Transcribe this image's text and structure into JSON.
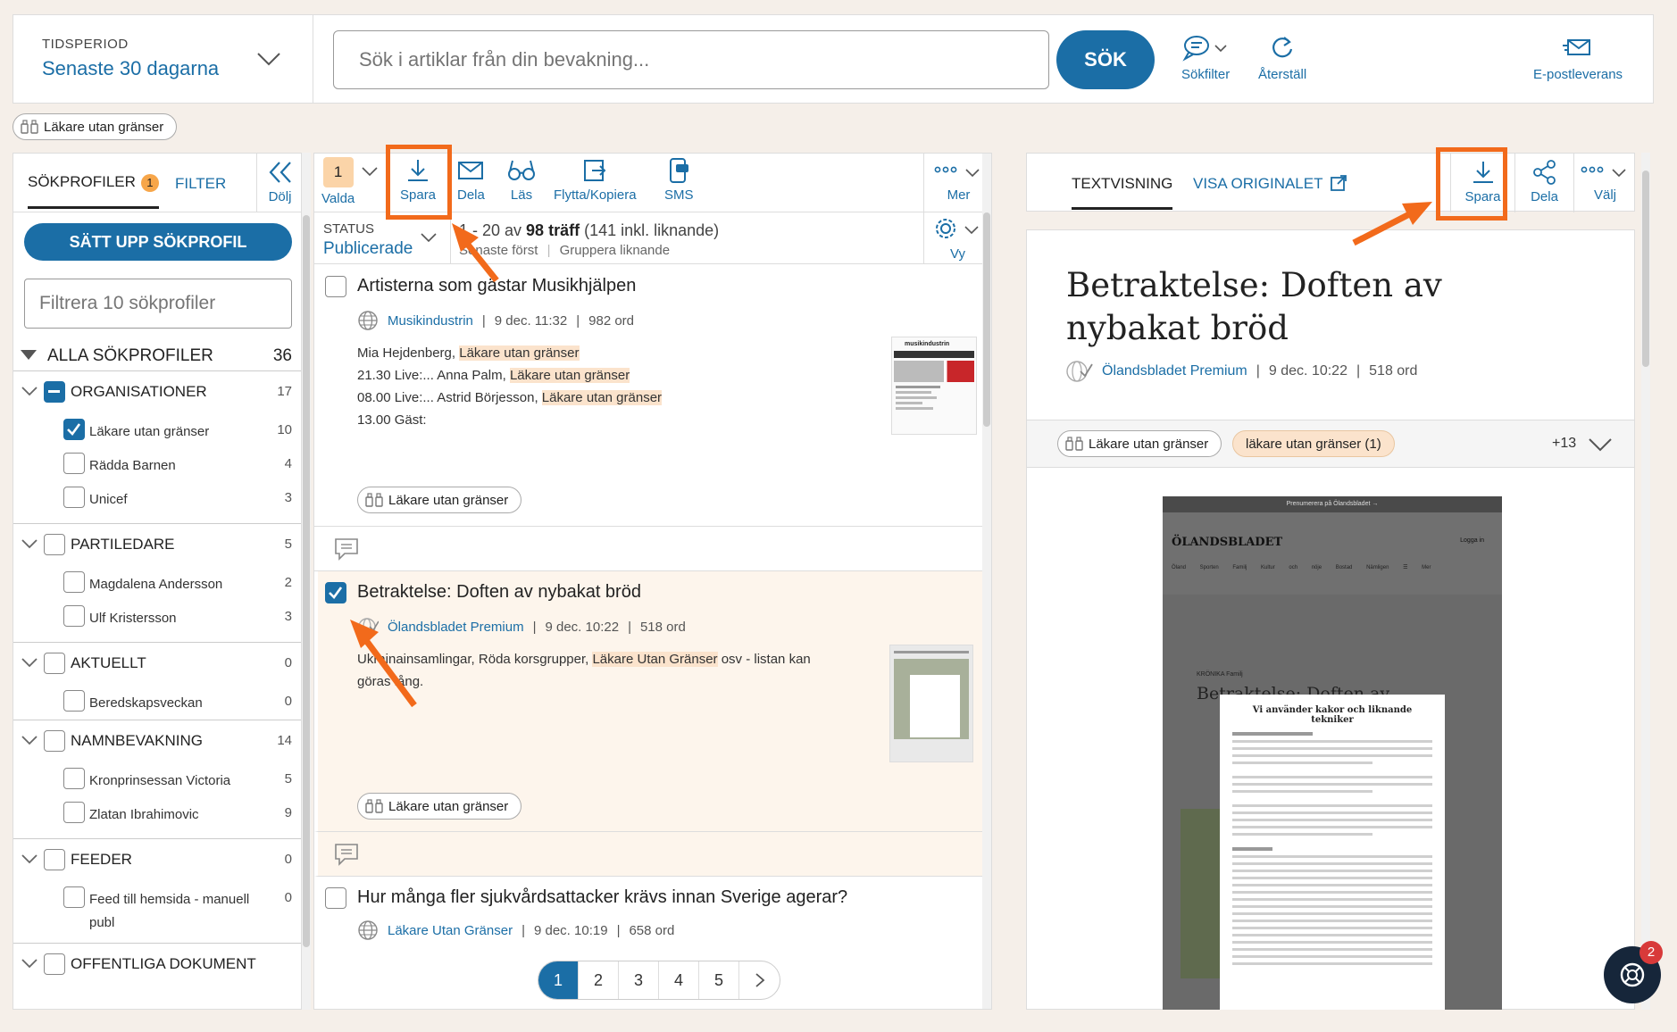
{
  "header": {
    "period_label": "TIDSPERIOD",
    "period_value": "Senaste 30 dagarna",
    "search_placeholder": "Sök i artiklar från din bevakning...",
    "search_button": "SÖK",
    "tools": {
      "filters": "Sökfilter",
      "reset": "Återställ",
      "email": "E-postleverans"
    }
  },
  "active_filter_chip": "Läkare utan gränser",
  "left_panel": {
    "tab_profiles": "SÖKPROFILER",
    "tab_profiles_badge": "1",
    "tab_filter": "FILTER",
    "hide": "Dölj",
    "setup_button": "SÄTT UPP SÖKPROFIL",
    "filter_placeholder": "Filtrera 10 sökprofiler",
    "all_label": "ALLA SÖKPROFILER",
    "all_count": "36",
    "groups": [
      {
        "name": "ORGANISATIONER",
        "count": "17",
        "items": [
          {
            "name": "Läkare utan gränser",
            "count": "10"
          },
          {
            "name": "Rädda Barnen",
            "count": "4"
          },
          {
            "name": "Unicef",
            "count": "3"
          }
        ]
      },
      {
        "name": "PARTILEDARE",
        "count": "5",
        "items": [
          {
            "name": "Magdalena Andersson",
            "count": "2"
          },
          {
            "name": "Ulf Kristersson",
            "count": "3"
          }
        ]
      },
      {
        "name": "AKTUELLT",
        "count": "0",
        "items": [
          {
            "name": "Beredskapsveckan",
            "count": "0"
          }
        ]
      },
      {
        "name": "NAMNBEVAKNING",
        "count": "14",
        "items": [
          {
            "name": "Kronprinsessan Victoria",
            "count": "5"
          },
          {
            "name": "Zlatan Ibrahimovic",
            "count": "9"
          }
        ]
      },
      {
        "name": "FEEDER",
        "count": "0",
        "items": [
          {
            "name": "Feed till hemsida - manuell publ",
            "count": "0"
          }
        ]
      },
      {
        "name": "OFFENTLIGA DOKUMENT",
        "count": "",
        "items": []
      }
    ]
  },
  "middle_panel": {
    "toolbar": {
      "selected_count": "1",
      "selected": "Valda",
      "save": "Spara",
      "share": "Dela",
      "read": "Läs",
      "move": "Flytta/Kopiera",
      "sms": "SMS",
      "more": "Mer"
    },
    "status_label": "STATUS",
    "status_value": "Publicerade",
    "hits_prefix": "1 - 20 av ",
    "hits_bold": "98 träff",
    "hits_suffix": " (141 inkl. liknande)",
    "sort": "Senaste först",
    "group_similar": "Gruppera liknande",
    "view": "Vy",
    "articles": [
      {
        "title": "Artisterna som gästar Musikhjälpen",
        "source": "Musikindustrin",
        "date": "9 dec. 11:32",
        "words": "982 ord",
        "lines": [
          {
            "pre": "Mia Hejdenberg, ",
            "hl": "Läkare utan gränser"
          },
          {
            "pre": "21.30 Live:... Anna Palm, ",
            "hl": "Läkare utan gränser"
          },
          {
            "pre": "08.00 Live:... Astrid Börjesson, ",
            "hl": "Läkare utan gränser"
          },
          {
            "pre": "13.00 Gäst:",
            "hl": ""
          }
        ],
        "tag": "Läkare utan gränser",
        "thumb_label": "musikindustrin",
        "checked": false
      },
      {
        "title": "Betraktelse: Doften av nybakat bröd",
        "source": "Ölandsbladet Premium",
        "date": "9 dec. 10:22",
        "words": "518 ord",
        "snippet_pre": "Ukrainainsamlingar, Röda korsgrupper, ",
        "snippet_hl": "Läkare Utan Gränser",
        "snippet_post": " osv - listan kan göras lång.",
        "tag": "Läkare utan gränser",
        "checked": true
      },
      {
        "title": "Hur många fler sjukvårdsattacker krävs innan Sverige agerar?",
        "source": "Läkare Utan Gränser",
        "date": "9 dec. 10:19",
        "words": "658 ord",
        "checked": false
      }
    ],
    "pages": [
      "1",
      "2",
      "3",
      "4",
      "5"
    ]
  },
  "right_panel": {
    "tab_text": "TEXTVISNING",
    "tab_original": "VISA ORIGINALET",
    "save": "Spara",
    "share": "Dela",
    "choose": "Välj",
    "title": "Betraktelse: Doften av nybakat bröd",
    "source": "Ölandsbladet Premium",
    "date": "9 dec. 10:22",
    "words": "518 ord",
    "chip_profile": "Läkare utan gränser",
    "chip_keyword": "läkare utan gränser (1)",
    "more_count": "+13",
    "preview": {
      "top_banner": "Prenumerera på Ölandsbladet →",
      "logo": "ÖLANDSBLADET",
      "login": "Logga in",
      "nav": "Öland Sporten Familj Kultur och nöje Bostad Nämligen ☰ Mer",
      "category": "KRÖNIKA Familj",
      "article_title": "Betraktelse: Doften av",
      "popup_title": "Vi använder kakor och liknande tekniker"
    }
  },
  "help_badge": "2",
  "colors": {
    "brand": "#1b6ea6",
    "accent": "#f7a64a",
    "highlight": "#fbe3cc",
    "annotation": "#f26a1b"
  }
}
